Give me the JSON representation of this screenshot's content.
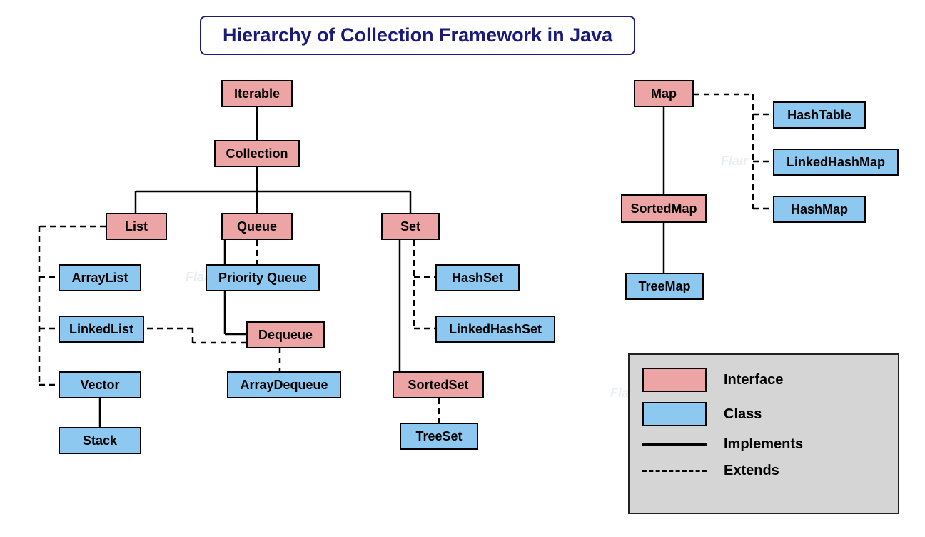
{
  "title": "Hierarchy of Collection Framework in Java",
  "colors": {
    "interface_bg": "#eda4a4",
    "class_bg": "#8cc8f0",
    "title_border": "#1a1a7a"
  },
  "nodes": {
    "iterable": "Iterable",
    "collection": "Collection",
    "list": "List",
    "queue": "Queue",
    "set": "Set",
    "arraylist": "ArrayList",
    "linkedlist": "LinkedList",
    "vector": "Vector",
    "stack": "Stack",
    "priorityqueue": "Priority Queue",
    "dequeue": "Dequeue",
    "arraydequeue": "ArrayDequeue",
    "hashset": "HashSet",
    "linkedhashset": "LinkedHashSet",
    "sortedset": "SortedSet",
    "treeset": "TreeSet",
    "map": "Map",
    "sortedmap": "SortedMap",
    "treemap": "TreeMap",
    "hashtable": "HashTable",
    "linkedhashmap": "LinkedHashMap",
    "hashmap": "HashMap"
  },
  "legend": {
    "interface": "Interface",
    "class": "Class",
    "implements": "Implements",
    "extends": "Extends"
  },
  "connections": {
    "solid": [
      {
        "from": "iterable",
        "to": "collection"
      },
      {
        "from": "collection",
        "to": "list"
      },
      {
        "from": "collection",
        "to": "queue"
      },
      {
        "from": "collection",
        "to": "set"
      },
      {
        "from": "queue",
        "to": "dequeue"
      },
      {
        "from": "set",
        "to": "sortedset"
      },
      {
        "from": "vector",
        "to": "stack"
      },
      {
        "from": "map",
        "to": "sortedmap"
      },
      {
        "from": "sortedmap",
        "to": "treemap"
      }
    ],
    "dashed": [
      {
        "from": "list",
        "to": "arraylist"
      },
      {
        "from": "list",
        "to": "linkedlist"
      },
      {
        "from": "list",
        "to": "vector"
      },
      {
        "from": "queue",
        "to": "priorityqueue"
      },
      {
        "from": "dequeue",
        "to": "arraydequeue"
      },
      {
        "from": "dequeue",
        "to": "linkedlist"
      },
      {
        "from": "set",
        "to": "hashset"
      },
      {
        "from": "set",
        "to": "linkedhashset"
      },
      {
        "from": "sortedset",
        "to": "treeset"
      },
      {
        "from": "map",
        "to": "hashtable"
      },
      {
        "from": "map",
        "to": "linkedhashmap"
      },
      {
        "from": "map",
        "to": "hashmap"
      }
    ]
  }
}
